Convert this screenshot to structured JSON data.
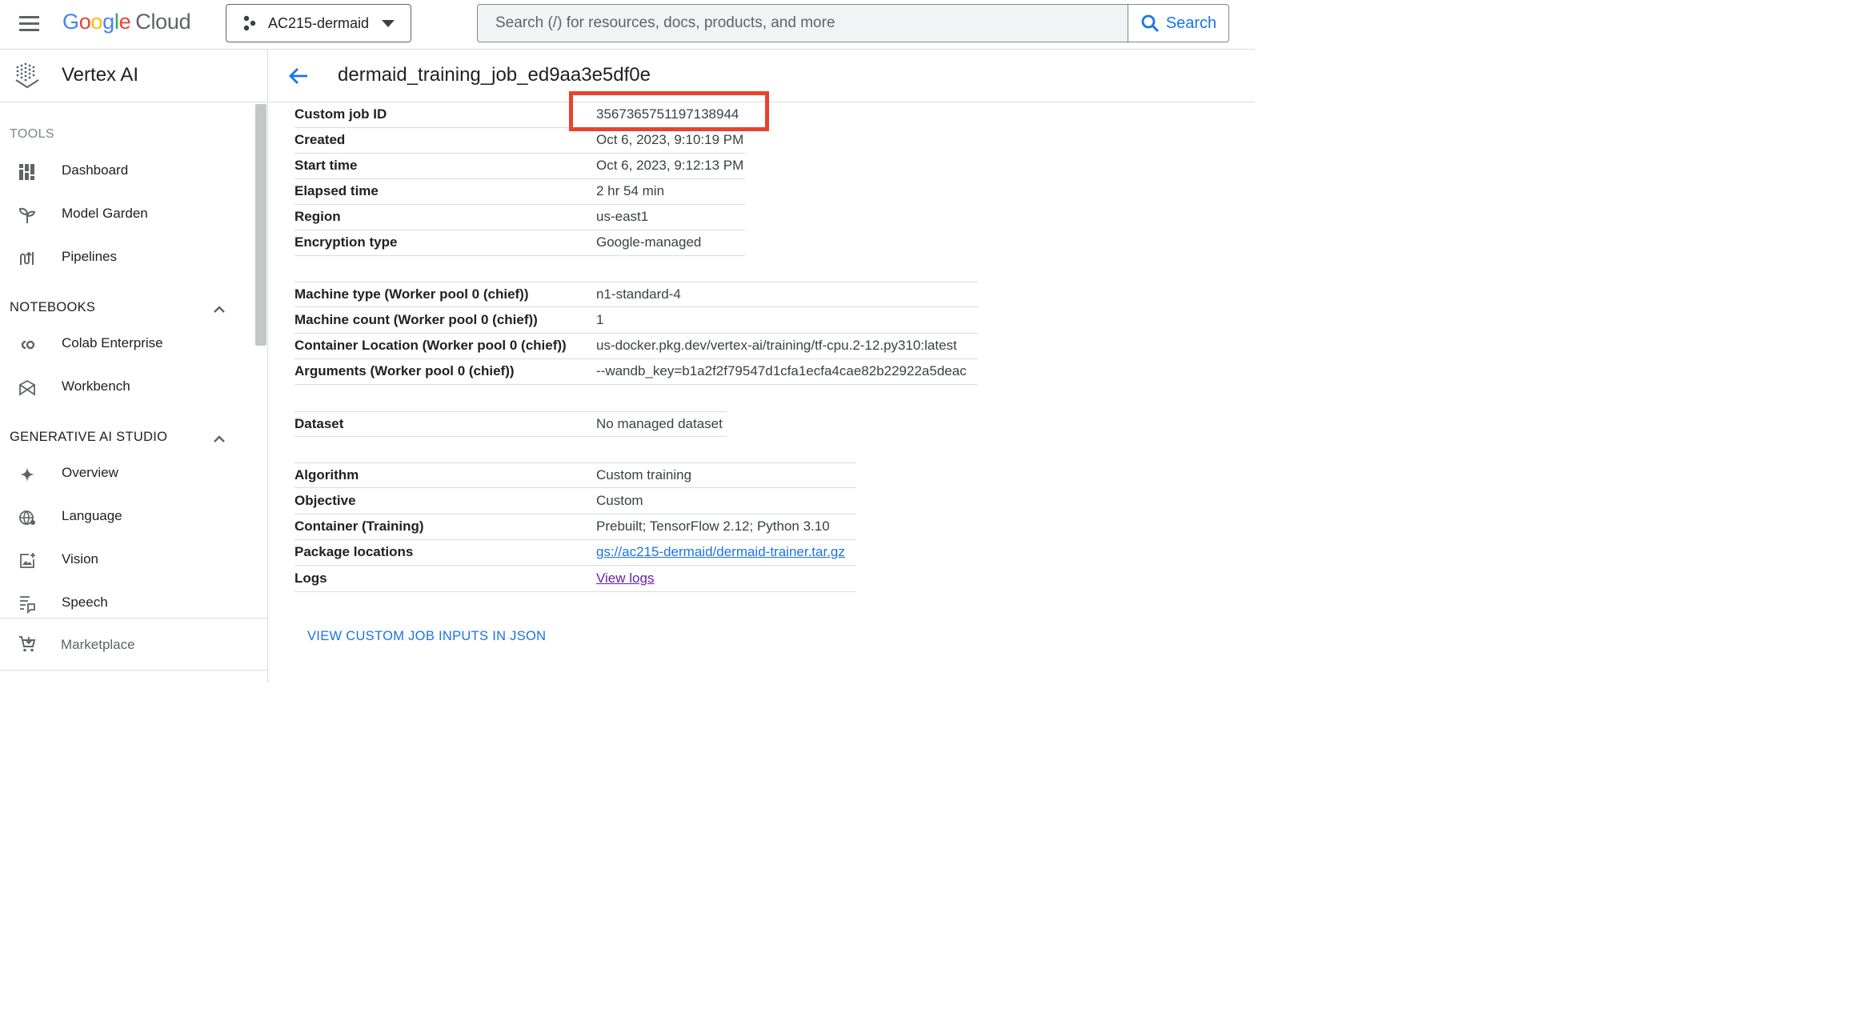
{
  "topbar": {
    "logo_letters": [
      "G",
      "o",
      "o",
      "g",
      "l",
      "e"
    ],
    "logo_cloud": "Cloud",
    "project_name": "AC215-dermaid",
    "search_placeholder": "Search (/) for resources, docs, products, and more",
    "search_button": "Search"
  },
  "sidebar": {
    "product_title": "Vertex AI",
    "tools_label": "TOOLS",
    "tools_items": [
      {
        "label": "Dashboard",
        "icon": "dashboard-icon"
      },
      {
        "label": "Model Garden",
        "icon": "sprout-icon"
      },
      {
        "label": "Pipelines",
        "icon": "pipelines-icon"
      }
    ],
    "notebooks_label": "NOTEBOOKS",
    "notebooks_items": [
      {
        "label": "Colab Enterprise",
        "icon": "colab-icon"
      },
      {
        "label": "Workbench",
        "icon": "workbench-icon"
      }
    ],
    "genai_label": "GENERATIVE AI STUDIO",
    "genai_items": [
      {
        "label": "Overview",
        "icon": "sparkle-icon"
      },
      {
        "label": "Language",
        "icon": "language-icon"
      },
      {
        "label": "Vision",
        "icon": "vision-icon"
      },
      {
        "label": "Speech",
        "icon": "speech-icon"
      }
    ],
    "marketplace_label": "Marketplace"
  },
  "main": {
    "title": "dermaid_training_job_ed9aa3e5df0e",
    "group1": [
      {
        "key": "Custom job ID",
        "value": "3567365751197138944"
      },
      {
        "key": "Created",
        "value": "Oct 6, 2023, 9:10:19 PM"
      },
      {
        "key": "Start time",
        "value": "Oct 6, 2023, 9:12:13 PM"
      },
      {
        "key": "Elapsed time",
        "value": "2 hr 54 min"
      },
      {
        "key": "Region",
        "value": "us-east1"
      },
      {
        "key": "Encryption type",
        "value": "Google-managed"
      }
    ],
    "group2": [
      {
        "key": "Machine type (Worker pool 0 (chief))",
        "value": "n1-standard-4"
      },
      {
        "key": "Machine count (Worker pool 0 (chief))",
        "value": "1"
      },
      {
        "key": "Container Location (Worker pool 0 (chief))",
        "value": "us-docker.pkg.dev/vertex-ai/training/tf-cpu.2-12.py310:latest"
      },
      {
        "key": "Arguments (Worker pool 0 (chief))",
        "value": "--wandb_key=b1a2f2f79547d1cfa1ecfa4cae82b22922a5deac"
      }
    ],
    "group3": [
      {
        "key": "Dataset",
        "value": "No managed dataset"
      }
    ],
    "group4": [
      {
        "key": "Algorithm",
        "value": "Custom training"
      },
      {
        "key": "Objective",
        "value": "Custom"
      },
      {
        "key": "Container (Training)",
        "value": "Prebuilt; TensorFlow 2.12; Python 3.10"
      },
      {
        "key": "Package locations",
        "value": "gs://ac215-dermaid/dermaid-trainer.tar.gz"
      },
      {
        "key": "Logs",
        "value": "View logs"
      }
    ],
    "json_link": "VIEW CUSTOM JOB INPUTS IN JSON"
  },
  "colors": {
    "accent": "#1a73e8",
    "highlight_box": "#e8432f",
    "visited_link": "#681da8"
  }
}
